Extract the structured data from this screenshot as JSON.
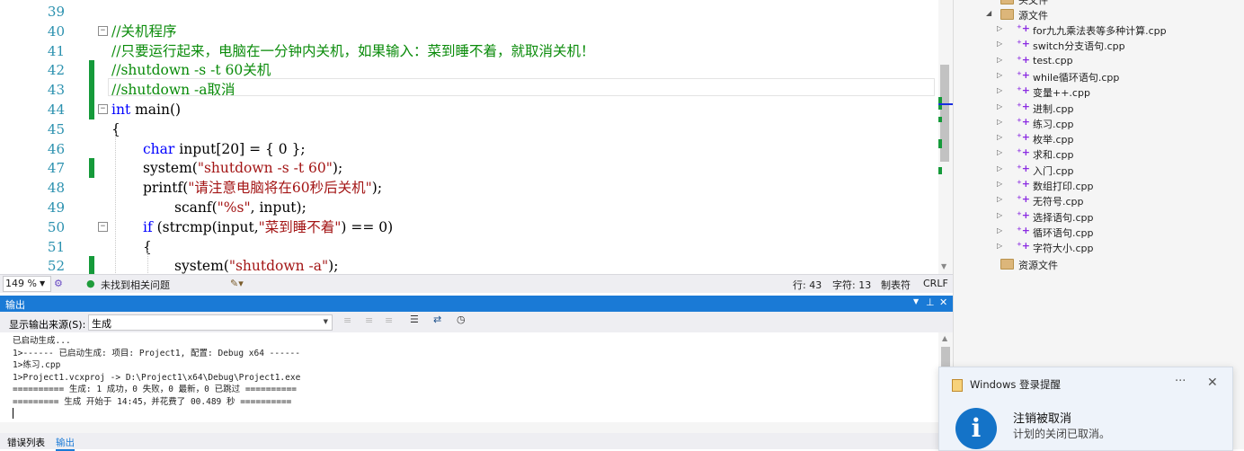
{
  "editor": {
    "lines": [
      {
        "num": "39",
        "segments": []
      },
      {
        "num": "40",
        "segments": [
          {
            "t": "//关机程序",
            "c": "comment"
          }
        ]
      },
      {
        "num": "41",
        "segments": [
          {
            "t": "//只要运行起来，电脑在一分钟内关机，如果输入：菜到睡不着，就取消关机！",
            "c": "comment"
          }
        ]
      },
      {
        "num": "42",
        "segments": [
          {
            "t": "//shutdown -s -t 60关机",
            "c": "comment"
          }
        ]
      },
      {
        "num": "43",
        "segments": [
          {
            "t": "//shutdown -a取消",
            "c": "comment"
          }
        ]
      },
      {
        "num": "44",
        "segments": [
          {
            "t": "int",
            "c": "kw"
          },
          {
            "t": " main()",
            "c": "plain"
          }
        ]
      },
      {
        "num": "45",
        "segments": [
          {
            "t": "{",
            "c": "plain"
          }
        ]
      },
      {
        "num": "46",
        "segments": [
          {
            "t": "char",
            "c": "kw"
          },
          {
            "t": " input[20] = { 0 };",
            "c": "plain"
          }
        ]
      },
      {
        "num": "47",
        "segments": [
          {
            "t": "system(",
            "c": "plain"
          },
          {
            "t": "\"shutdown -s -t 60\"",
            "c": "str"
          },
          {
            "t": ");",
            "c": "plain"
          }
        ]
      },
      {
        "num": "48",
        "segments": [
          {
            "t": "printf(",
            "c": "plain"
          },
          {
            "t": "\"请注意电脑将在60秒后关机\"",
            "c": "str"
          },
          {
            "t": ");",
            "c": "plain"
          }
        ]
      },
      {
        "num": "49",
        "segments": [
          {
            "t": "scanf(",
            "c": "plain"
          },
          {
            "t": "\"%s\"",
            "c": "str"
          },
          {
            "t": ", input);",
            "c": "plain"
          }
        ]
      },
      {
        "num": "50",
        "segments": [
          {
            "t": "if",
            "c": "kw"
          },
          {
            "t": " (strcmp(input,",
            "c": "plain"
          },
          {
            "t": "\"菜到睡不着\"",
            "c": "str"
          },
          {
            "t": ") == 0)",
            "c": "plain"
          }
        ]
      },
      {
        "num": "51",
        "segments": [
          {
            "t": "{",
            "c": "plain"
          }
        ]
      },
      {
        "num": "52",
        "segments": [
          {
            "t": "system(",
            "c": "plain"
          },
          {
            "t": "\"shutdown -a\"",
            "c": "str"
          },
          {
            "t": ");",
            "c": "plain"
          }
        ]
      }
    ],
    "colors": {
      "comment": "#0a8b0a",
      "kw": "#0000ff",
      "str": "#a31515",
      "plain": "#000000",
      "changed": "#159a3a"
    }
  },
  "status_bar": {
    "zoom": "149 %",
    "issues": "未找到相关问题",
    "line": "行: 43",
    "char": "字符: 13",
    "tabs": "制表符",
    "eol": "CRLF"
  },
  "output_panel": {
    "title": "输出",
    "source_label": "显示输出来源(S):",
    "source_value": "生成",
    "lines": [
      "已启动生成...",
      "1>------ 已启动生成: 项目: Project1, 配置: Debug x64 ------",
      "1>练习.cpp",
      "1>Project1.vcxproj -> D:\\Project1\\x64\\Debug\\Project1.exe",
      "========== 生成: 1 成功，0 失败，0 最新，0 已跳过 ==========",
      "========= 生成 开始于 14:45，并花费了 00.489 秒 =========="
    ]
  },
  "bottom_tabs": {
    "errors": "错误列表",
    "output": "输出"
  },
  "explorer": {
    "top_cut": "头文件",
    "source_folder": "源文件",
    "files": [
      "for九九乘法表等多种计算.cpp",
      "switch分支语句.cpp",
      "test.cpp",
      "while循环语句.cpp",
      "变量++.cpp",
      "进制.cpp",
      "练习.cpp",
      "枚举.cpp",
      "求和.cpp",
      "入门.cpp",
      "数组打印.cpp",
      "无符号.cpp",
      "选择语句.cpp",
      "循环语句.cpp",
      "字符大小.cpp"
    ],
    "resource_folder": "资源文件"
  },
  "toast": {
    "app": "Windows 登录提醒",
    "more": "···",
    "close": "✕",
    "icon": "i",
    "title": "注销被取消",
    "body": "计划的关闭已取消。"
  },
  "icons": {
    "fold": "minus-box-icon",
    "cpp": "cpp-file-icon",
    "folder": "folder-icon",
    "info": "info-icon"
  }
}
